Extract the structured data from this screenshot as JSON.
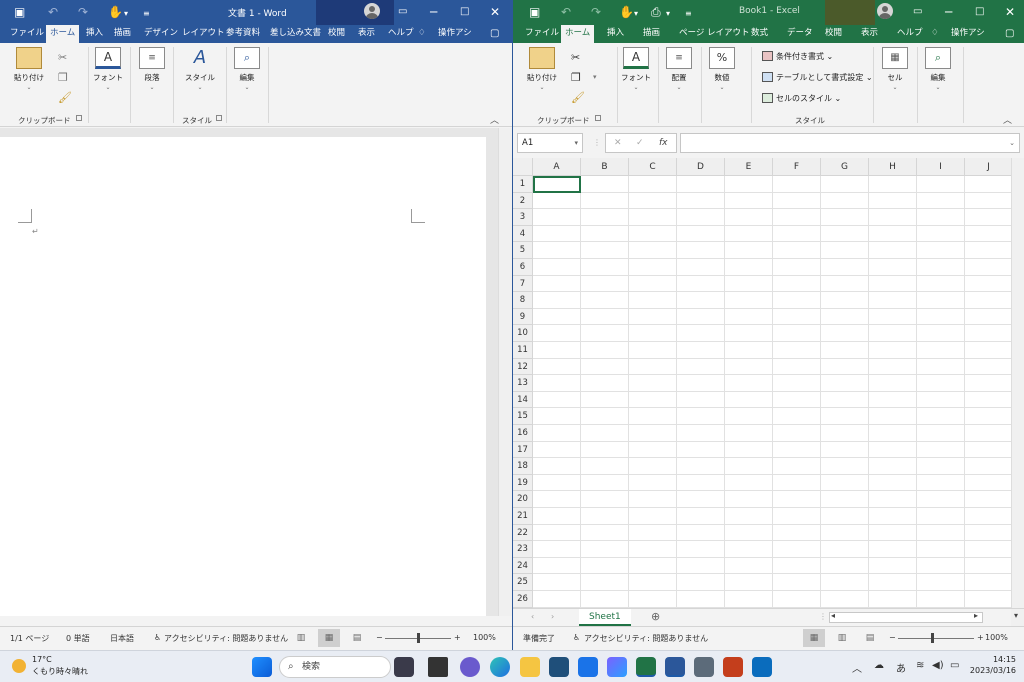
{
  "word": {
    "title": "文書 1  -  Word",
    "menu": [
      "ファイル",
      "ホーム",
      "挿入",
      "描画",
      "デザイン",
      "レイアウト",
      "参考資料",
      "差し込み文書",
      "校閲",
      "表示",
      "ヘルプ",
      "操作アシ"
    ],
    "groups": {
      "paste": "貼り付け",
      "clipboard": "クリップボード",
      "font": "フォント",
      "paragraph": "段落",
      "style": "スタイル",
      "style_group": "スタイル",
      "edit": "編集"
    },
    "status": {
      "pages": "1/1 ページ",
      "words": "0 単語",
      "lang": "日本語",
      "access": "アクセシビリティ: 問題ありません",
      "zoom": "100%"
    }
  },
  "excel": {
    "title": "Book1  -  Excel",
    "menu": [
      "ファイル",
      "ホーム",
      "挿入",
      "描画",
      "ページ レイアウト",
      "数式",
      "データ",
      "校閲",
      "表示",
      "ヘルプ",
      "操作アシ"
    ],
    "groups": {
      "paste": "貼り付け",
      "clipboard": "クリップボード",
      "font": "フォント",
      "align": "配置",
      "number": "数値",
      "cond": "条件付き書式",
      "table": "テーブルとして書式設定",
      "cellstyle": "セルのスタイル",
      "style_group": "スタイル",
      "cells": "セル",
      "edit": "編集"
    },
    "namebox": "A1",
    "fx": "fx",
    "columns": [
      "A",
      "B",
      "C",
      "D",
      "E",
      "F",
      "G",
      "H",
      "I",
      "J"
    ],
    "rows": [
      "1",
      "2",
      "3",
      "4",
      "5",
      "6",
      "7",
      "8",
      "9",
      "10",
      "11",
      "12",
      "13",
      "14",
      "15",
      "16",
      "17",
      "18",
      "19",
      "20",
      "21",
      "22",
      "23",
      "24",
      "25",
      "26"
    ],
    "sheet": "Sheet1",
    "status": {
      "ready": "準備完了",
      "access": "アクセシビリティ: 問題ありません",
      "zoom": "100%"
    }
  },
  "taskbar": {
    "temp": "17°C",
    "weather": "くもり時々晴れ",
    "search": "検索",
    "ime": "あ",
    "time": "14:15",
    "date": "2023/03/16"
  }
}
